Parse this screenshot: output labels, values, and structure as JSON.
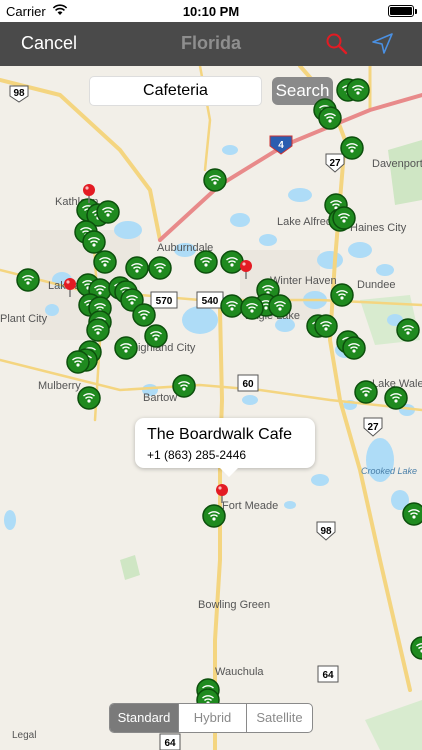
{
  "status_bar": {
    "carrier": "Carrier",
    "time": "10:10 PM"
  },
  "nav": {
    "cancel_label": "Cancel",
    "title": "Florida"
  },
  "search": {
    "value": "Cafeteria",
    "button_label": "Search"
  },
  "callout": {
    "name": "The Boardwalk Cafe",
    "phone": "+1 (863) 285-2446"
  },
  "map_type": {
    "options": [
      "Standard",
      "Hybrid",
      "Satellite"
    ],
    "selected": "Standard"
  },
  "legal_label": "Legal",
  "colors": {
    "nav_bg": "#4a4a4a",
    "marker_green": "#1f8a1f",
    "pin_red": "#e31b23",
    "water": "#aedcf7",
    "road_yellow": "#f4d580"
  },
  "places": [
    "Kathleen",
    "Lakeland",
    "Auburndale",
    "Lake Alfred",
    "Haines City",
    "Davenport",
    "Winter Haven",
    "Dundee",
    "Eagle Lake",
    "Highland City",
    "Bartow",
    "Mulberry",
    "Plant City",
    "Lake Wales",
    "Fort Meade",
    "Bowling Green",
    "Wauchula",
    "Crooked Lake"
  ],
  "road_shields": [
    "98",
    "4",
    "27",
    "570",
    "540",
    "60",
    "27",
    "98",
    "64",
    "64"
  ]
}
